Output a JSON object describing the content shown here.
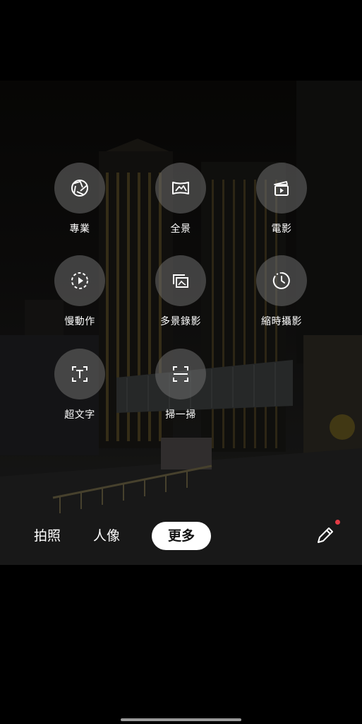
{
  "modes": [
    {
      "label": "專業",
      "icon": "aperture-icon"
    },
    {
      "label": "全景",
      "icon": "panorama-icon"
    },
    {
      "label": "電影",
      "icon": "clapper-icon"
    },
    {
      "label": "慢動作",
      "icon": "slow-motion-icon"
    },
    {
      "label": "多景錄影",
      "icon": "multi-view-icon"
    },
    {
      "label": "縮時攝影",
      "icon": "timelapse-icon"
    },
    {
      "label": "超文字",
      "icon": "text-scan-icon"
    },
    {
      "label": "掃一掃",
      "icon": "scan-icon"
    }
  ],
  "modebar": {
    "photo": "拍照",
    "portrait": "人像",
    "more": "更多"
  },
  "colors": {
    "active_tab_bg": "#ffffff",
    "notification_dot": "#e33b45"
  }
}
